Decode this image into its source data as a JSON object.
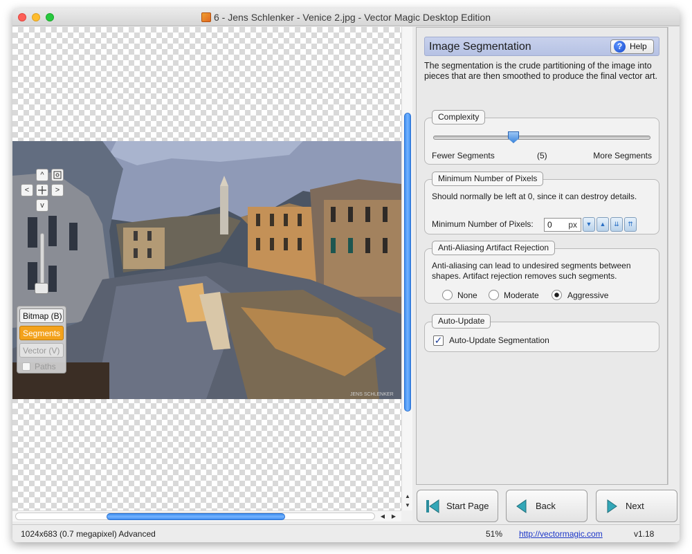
{
  "window": {
    "title": "6 - Jens Schlenker - Venice 2.jpg - Vector Magic Desktop Edition"
  },
  "canvas": {
    "watermark": "JENS SCHLENKER",
    "view_modes": {
      "bitmap": "Bitmap (B)",
      "segments": "Segments",
      "vector": "Vector (V)",
      "paths": "Paths"
    },
    "nav_glyphs": {
      "up": "^",
      "down": "v",
      "left": "<",
      "right": ">"
    }
  },
  "panel": {
    "header": {
      "title": "Image Segmentation",
      "help_label": "Help"
    },
    "intro": "The segmentation is the crude partitioning of the image into pieces that are then smoothed to produce the final vector art.",
    "complexity": {
      "label": "Complexity",
      "fewer": "Fewer Segments",
      "value": "(5)",
      "more": "More Segments"
    },
    "min_pixels": {
      "label": "Minimum Number of Pixels",
      "description": "Should normally be left at 0, since it can destroy details.",
      "field_label": "Minimum Number of Pixels:",
      "value": "0",
      "unit": "px"
    },
    "anti_aliasing": {
      "label": "Anti-Aliasing Artifact Rejection",
      "description": "Anti-aliasing can lead to undesired segments between shapes. Artifact rejection removes such segments.",
      "options": [
        "None",
        "Moderate",
        "Aggressive"
      ],
      "selected": "Aggressive"
    },
    "auto_update": {
      "label": "Auto-Update",
      "checkbox_label": "Auto-Update Segmentation",
      "checked": true
    }
  },
  "nav": {
    "start": "Start Page",
    "back": "Back",
    "next": "Next"
  },
  "status": {
    "info": "1024x683 (0.7 megapixel)  Advanced",
    "zoom": "51%",
    "link": "http://vectormagic.com",
    "version": "v1.18"
  }
}
